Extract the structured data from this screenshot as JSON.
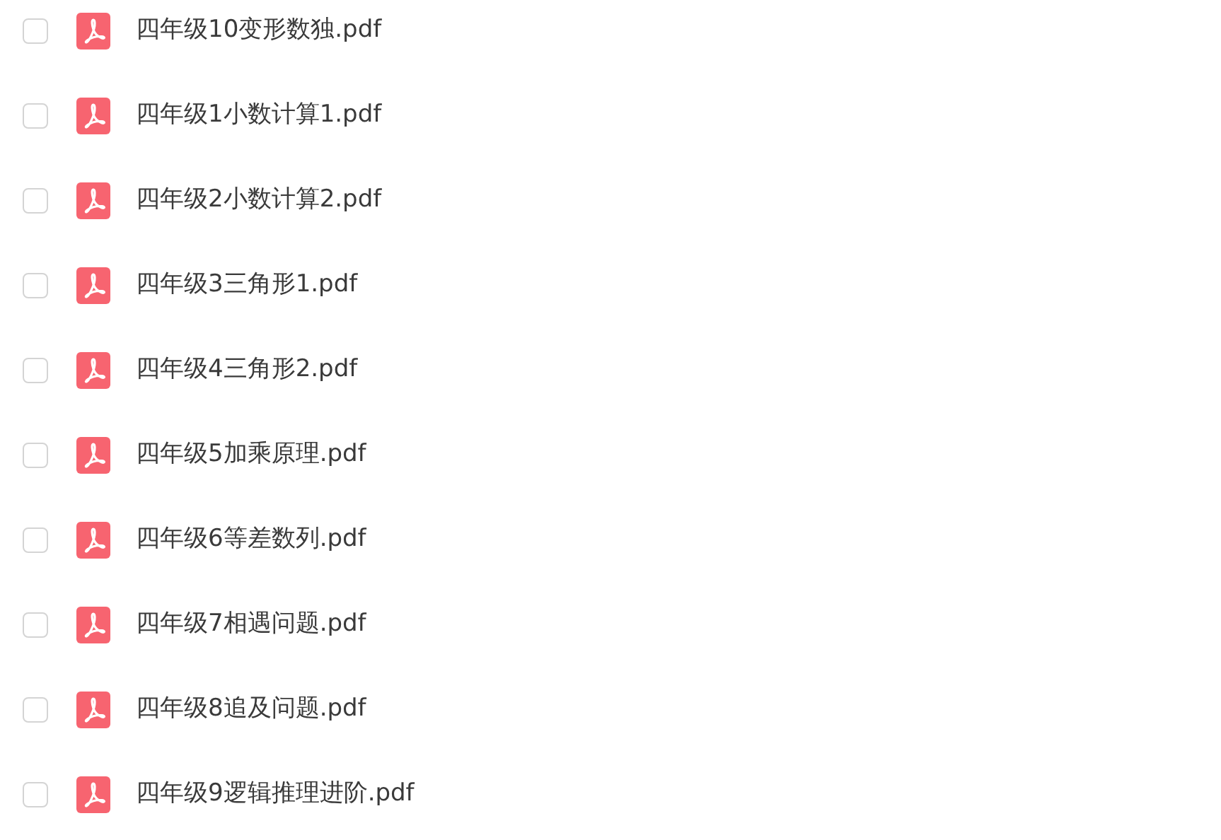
{
  "files": [
    {
      "name": "四年级10变形数独.pdf",
      "checked": false
    },
    {
      "name": "四年级1小数计算1.pdf",
      "checked": false
    },
    {
      "name": "四年级2小数计算2.pdf",
      "checked": false
    },
    {
      "name": "四年级3三角形1.pdf",
      "checked": false
    },
    {
      "name": "四年级4三角形2.pdf",
      "checked": false
    },
    {
      "name": "四年级5加乘原理.pdf",
      "checked": false
    },
    {
      "name": "四年级6等差数列.pdf",
      "checked": false
    },
    {
      "name": "四年级7相遇问题.pdf",
      "checked": false
    },
    {
      "name": "四年级8追及问题.pdf",
      "checked": false
    },
    {
      "name": "四年级9逻辑推理进阶.pdf",
      "checked": false
    }
  ]
}
